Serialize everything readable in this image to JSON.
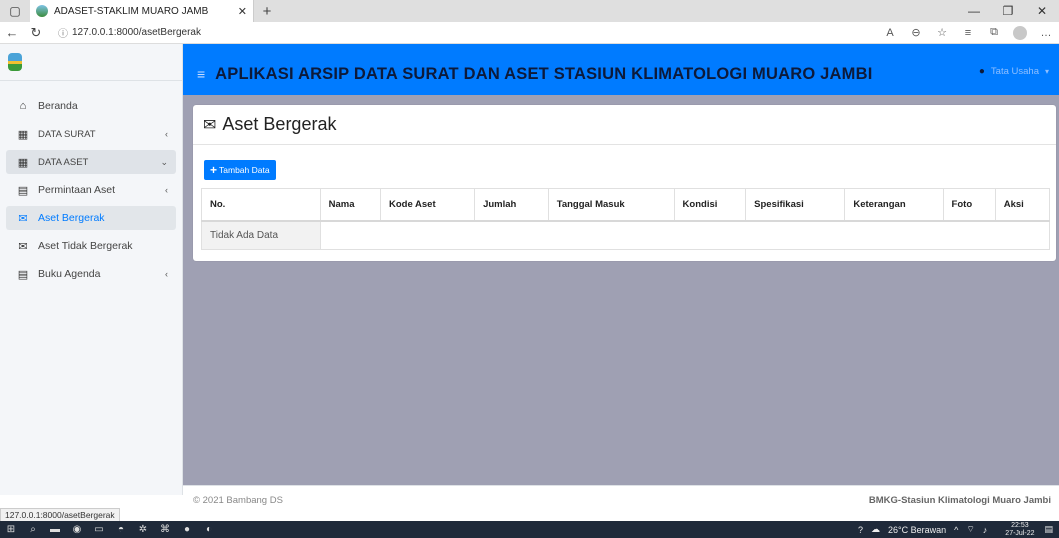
{
  "browser": {
    "tab_title": "ADASET-STAKLIM MUARO JAMB",
    "url": "127.0.0.1:8000/asetBergerak",
    "status_url": "127.0.0.1:8000/asetBergerak"
  },
  "header": {
    "title": "APLIKASI ARSIP DATA SURAT DAN ASET STASIUN KLIMATOLOGI MUARO JAMBI",
    "user": "Tata Usaha"
  },
  "sidebar": {
    "items": [
      {
        "label": "Beranda",
        "icon": "home-icon"
      },
      {
        "label": "DATA SURAT",
        "icon": "database-icon"
      },
      {
        "label": "DATA ASET",
        "icon": "database-icon"
      },
      {
        "label": "Permintaan Aset",
        "icon": "book-icon"
      },
      {
        "label": "Aset Bergerak",
        "icon": "envelope-icon"
      },
      {
        "label": "Aset Tidak Bergerak",
        "icon": "envelope-open-icon"
      },
      {
        "label": "Buku Agenda",
        "icon": "book-icon"
      }
    ]
  },
  "page": {
    "title": "Aset Bergerak",
    "add_button": "Tambah Data"
  },
  "table": {
    "columns": [
      "No.",
      "Nama",
      "Kode Aset",
      "Jumlah",
      "Tanggal Masuk",
      "Kondisi",
      "Spesifikasi",
      "Keterangan",
      "Foto",
      "Aksi"
    ],
    "empty_text": "Tidak Ada Data"
  },
  "footer": {
    "copyright": "© 2021 Bambang DS",
    "org": "BMKG-Stasiun Klimatologi Muaro Jambi"
  },
  "taskbar": {
    "weather": "26°C Berawan",
    "time": "22:53",
    "date": "27-Jul-22"
  },
  "colors": {
    "primary": "#007bff",
    "content_bg": "#9fa0b3",
    "sidebar_bg": "#f4f6f9"
  }
}
